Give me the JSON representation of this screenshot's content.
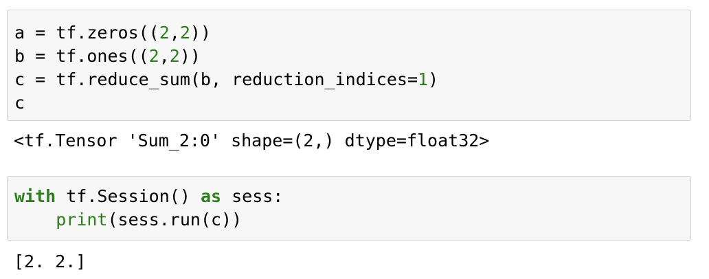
{
  "cells": [
    {
      "input_lines": [
        [
          {
            "t": "a = tf.zeros(("
          },
          {
            "t": "2",
            "c": "num"
          },
          {
            "t": ","
          },
          {
            "t": "2",
            "c": "num"
          },
          {
            "t": "))"
          }
        ],
        [
          {
            "t": "b = tf.ones(("
          },
          {
            "t": "2",
            "c": "num"
          },
          {
            "t": ","
          },
          {
            "t": "2",
            "c": "num"
          },
          {
            "t": "))"
          }
        ],
        [
          {
            "t": "c = tf.reduce_sum(b, reduction_indices="
          },
          {
            "t": "1",
            "c": "num"
          },
          {
            "t": ")"
          }
        ],
        [
          {
            "t": "c"
          }
        ]
      ],
      "output": "<tf.Tensor 'Sum_2:0' shape=(2,) dtype=float32>"
    },
    {
      "input_lines": [
        [
          {
            "t": "with",
            "c": "kw"
          },
          {
            "t": " tf.Session() "
          },
          {
            "t": "as",
            "c": "kw"
          },
          {
            "t": " sess:"
          }
        ],
        [
          {
            "t": "    "
          },
          {
            "t": "print",
            "c": "builtin"
          },
          {
            "t": "(sess.run(c))"
          }
        ]
      ],
      "output": "[2. 2.]"
    }
  ],
  "colors": {
    "cell_background": "#f7f7f7",
    "cell_border": "#cfcfcf",
    "keyword_green": "#2e7d1f"
  }
}
